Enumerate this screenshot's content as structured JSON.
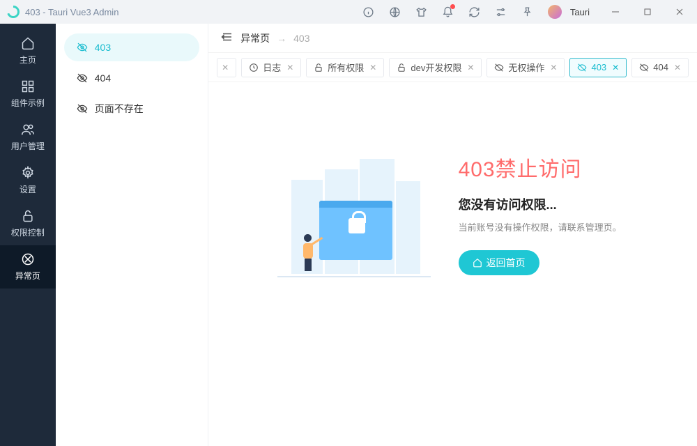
{
  "window": {
    "title": "403 - Tauri Vue3 Admin",
    "username": "Tauri"
  },
  "rail": {
    "items": [
      {
        "label": "主页",
        "icon": "home"
      },
      {
        "label": "组件示例",
        "icon": "grid"
      },
      {
        "label": "用户管理",
        "icon": "users"
      },
      {
        "label": "设置",
        "icon": "gear"
      },
      {
        "label": "权限控制",
        "icon": "lock"
      },
      {
        "label": "异常页",
        "icon": "denied"
      }
    ],
    "activeIndex": 5
  },
  "submenu": {
    "items": [
      {
        "label": "403",
        "active": true
      },
      {
        "label": "404",
        "active": false
      },
      {
        "label": "页面不存在",
        "active": false
      }
    ]
  },
  "breadcrumb": {
    "group": "异常页",
    "page": "403"
  },
  "tabs": [
    {
      "label": "",
      "icon": "none",
      "frag": true
    },
    {
      "label": "日志",
      "icon": "clock"
    },
    {
      "label": "所有权限",
      "icon": "lock"
    },
    {
      "label": "dev开发权限",
      "icon": "lock"
    },
    {
      "label": "无权操作",
      "icon": "eye-off"
    },
    {
      "label": "403",
      "icon": "eye-off",
      "active": true
    },
    {
      "label": "404",
      "icon": "eye-off"
    }
  ],
  "error": {
    "code_title": "403禁止访问",
    "heading": "您没有访问权限...",
    "description": "当前账号没有操作权限，请联系管理页。",
    "button": "返回首页"
  }
}
